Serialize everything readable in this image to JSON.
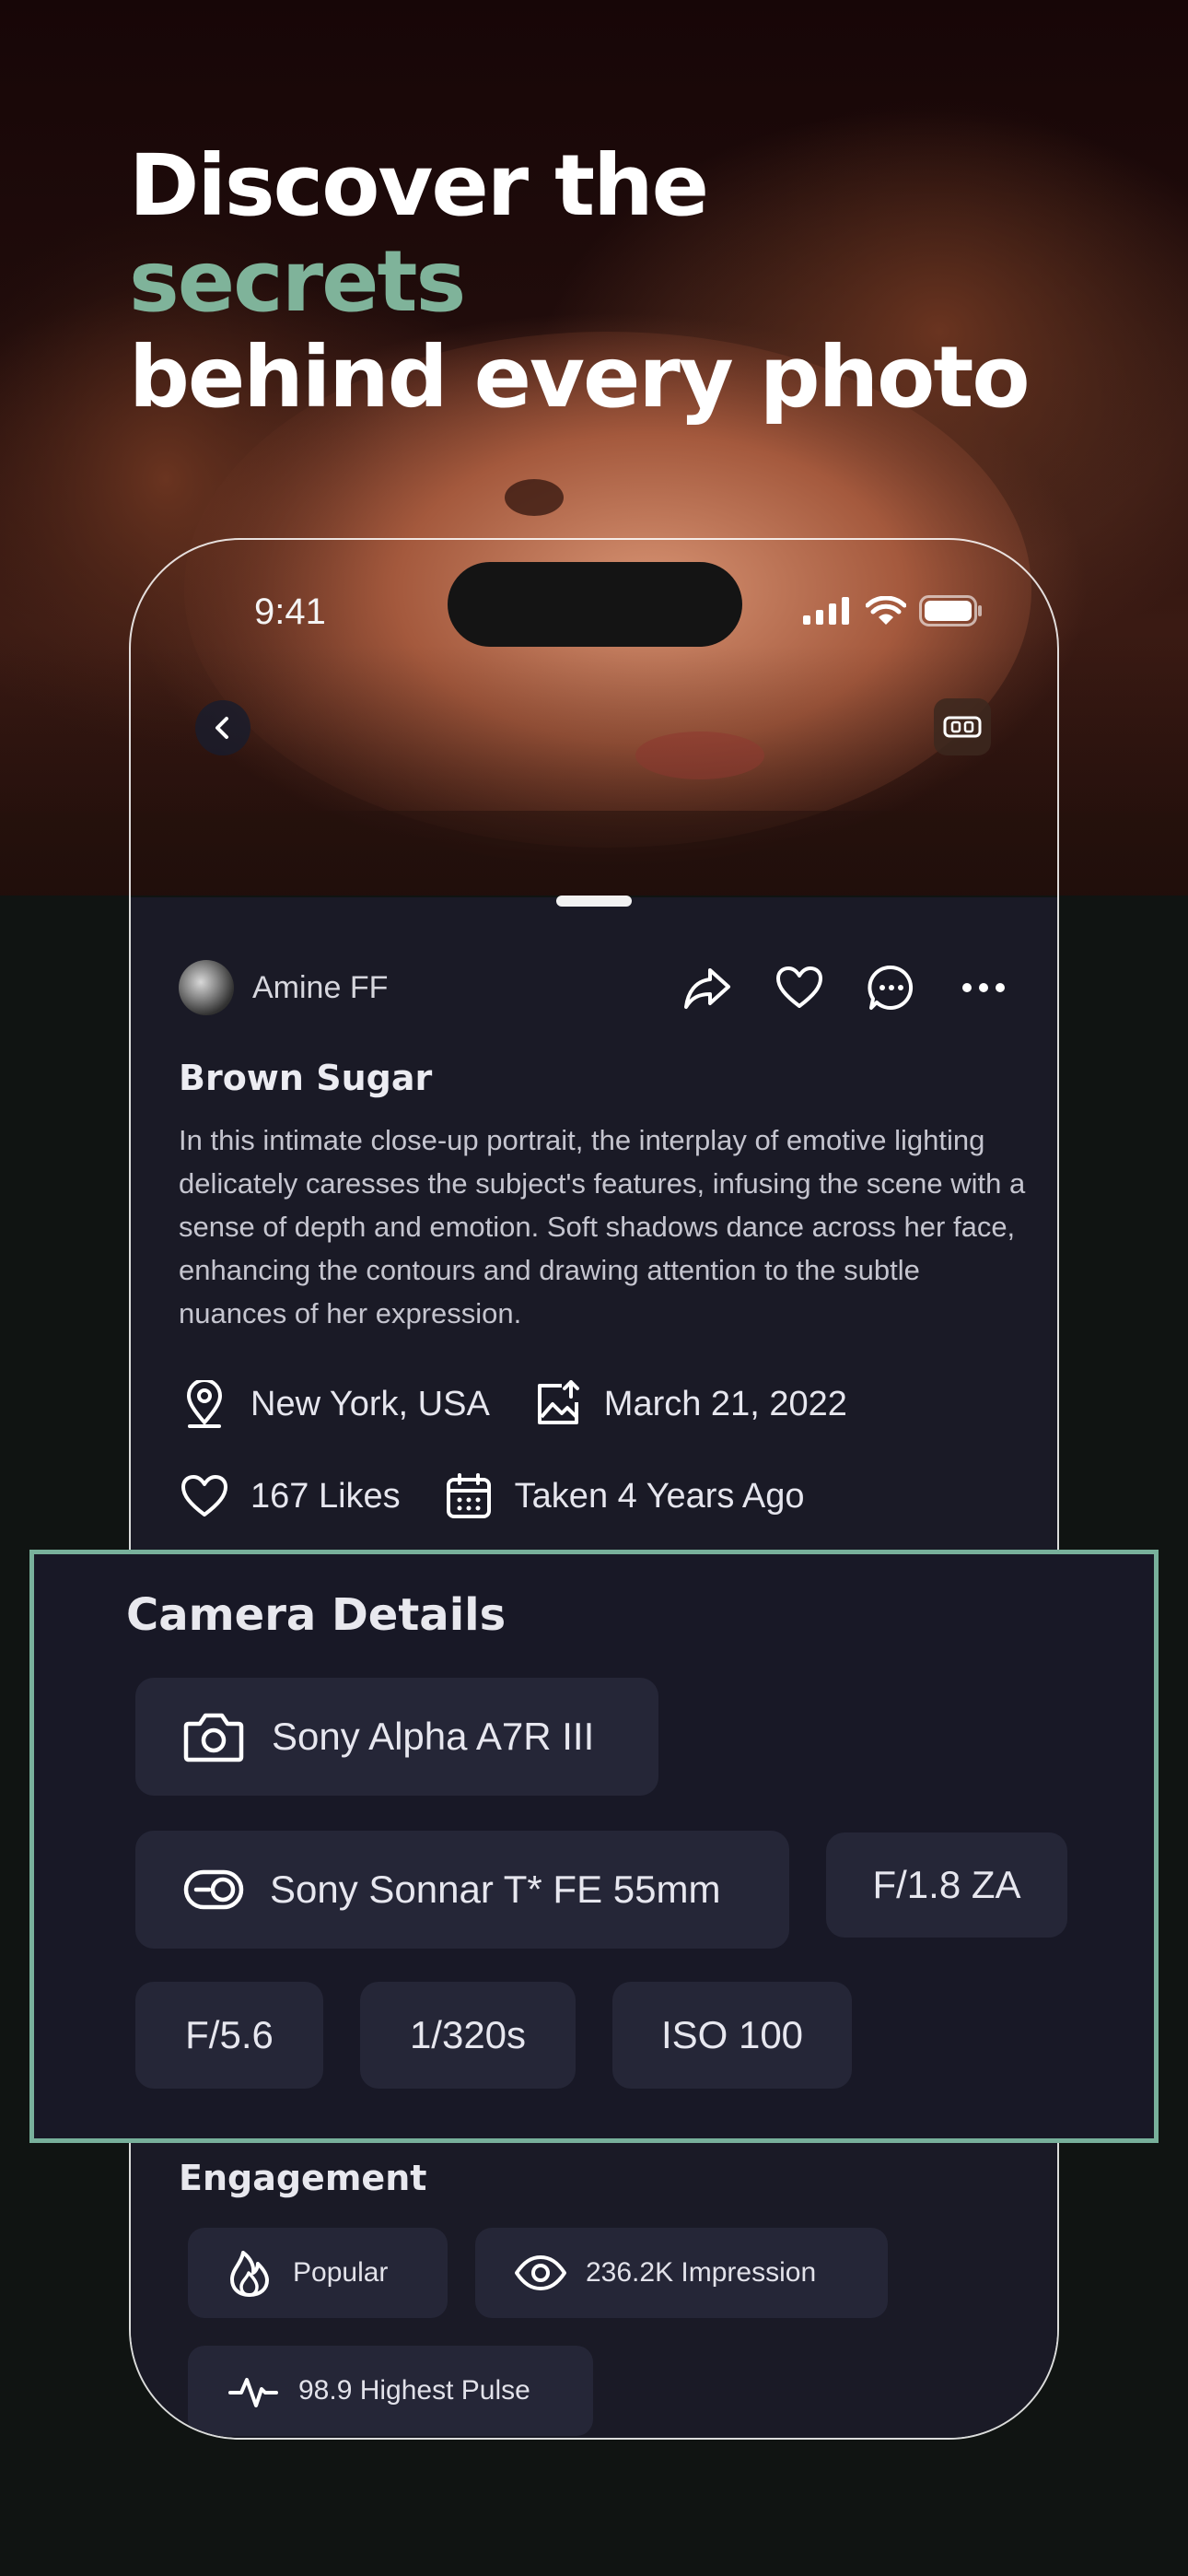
{
  "hero": {
    "headline_part1": "Discover the ",
    "headline_accent": "secrets",
    "headline_line2": "behind every photo"
  },
  "status_bar": {
    "time": "9:41",
    "icons": [
      "cellular-signal-icon",
      "wifi-icon",
      "battery-icon"
    ]
  },
  "top_buttons": {
    "back": "chevron-left-icon",
    "vr": "vr-headset-icon"
  },
  "post": {
    "author": "Amine FF",
    "actions": [
      "share-icon",
      "heart-icon",
      "comment-icon",
      "more-icon"
    ],
    "title": "Brown Sugar",
    "description": "In this intimate close-up portrait, the interplay of emotive lighting delicately caresses the subject's features, infusing the scene with a sense of depth and emotion. Soft shadows dance across her face, enhancing the contours and drawing attention to the subtle nuances of her expression.",
    "location": "New York, USA",
    "upload_date": "March 21, 2022",
    "likes": "167 Likes",
    "taken": "Taken 4 Years Ago"
  },
  "camera_details": {
    "heading": "Camera Details",
    "camera": "Sony Alpha A7R III",
    "lens": "Sony Sonnar T* FE 55mm",
    "lens_aperture": "F/1.8 ZA",
    "aperture": "F/5.6",
    "shutter": "1/320s",
    "iso": "ISO 100"
  },
  "engagement": {
    "heading": "Engagement",
    "popular": "Popular",
    "impressions": "236.2K Impression",
    "pulse": "98.9 Highest Pulse"
  },
  "colors": {
    "accent": "#7fb39a",
    "card_border": "#78b09b",
    "sheet_bg": "#1a1a26",
    "pill_bg": "#252637"
  }
}
